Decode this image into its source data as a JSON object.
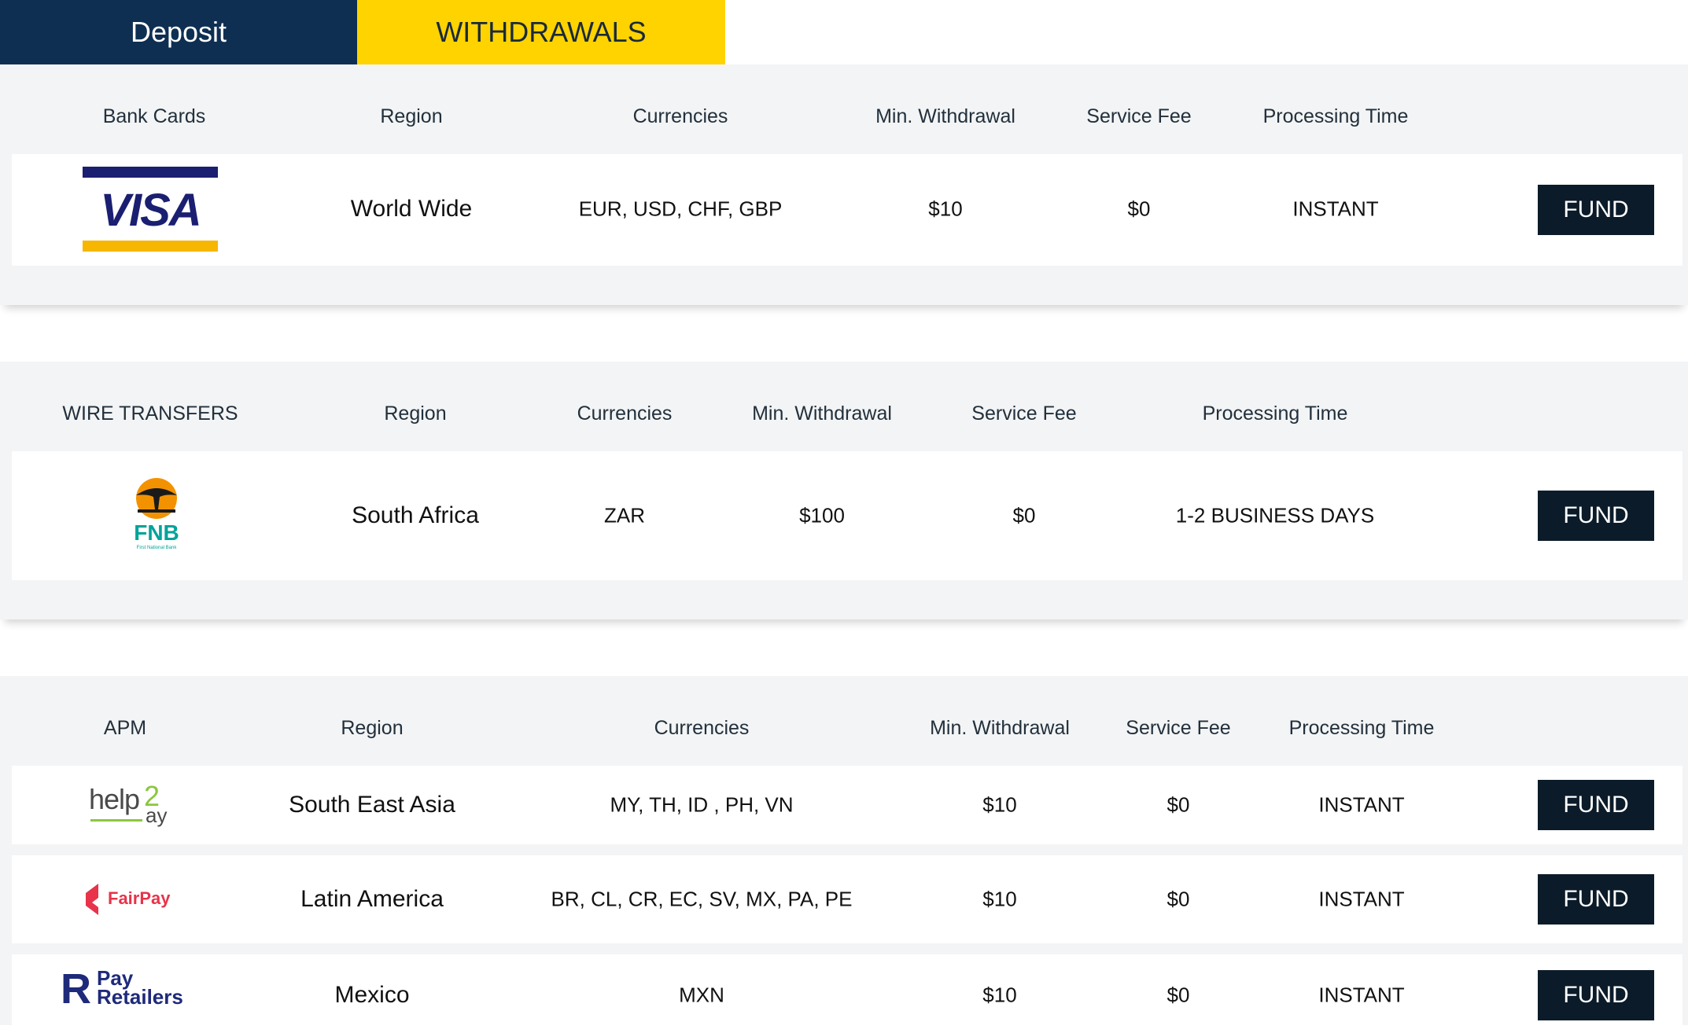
{
  "tabs": {
    "deposit": "Deposit",
    "withdrawals": "WITHDRAWALS"
  },
  "sections": {
    "bank_cards": {
      "headers": [
        "Bank Cards",
        "Region",
        "Currencies",
        "Min. Withdrawal",
        "Service Fee",
        "Processing Time"
      ],
      "rows": [
        {
          "logo": "visa-logo",
          "logo_text": "VISA",
          "region": "World Wide",
          "currencies": "EUR, USD, CHF, GBP",
          "min": "$10",
          "fee": "$0",
          "time": "INSTANT",
          "action": "FUND"
        }
      ]
    },
    "wire_transfers": {
      "headers": [
        "WIRE TRANSFERS",
        "Region",
        "Currencies",
        "Min. Withdrawal",
        "Service Fee",
        "Processing Time"
      ],
      "rows": [
        {
          "logo": "fnb-logo",
          "logo_text": "FNB",
          "logo_subtext": "First National Bank",
          "region": "South Africa",
          "currencies": "ZAR",
          "min": "$100",
          "fee": "$0",
          "time": "1-2 BUSINESS DAYS",
          "action": "FUND"
        }
      ]
    },
    "apm": {
      "headers": [
        "APM",
        "Region",
        "Currencies",
        "Min. Withdrawal",
        "Service Fee",
        "Processing Time"
      ],
      "rows": [
        {
          "logo": "help2pay-logo",
          "logo_text": "help2pay",
          "region": "South East Asia",
          "currencies": "MY, TH, ID , PH, VN",
          "min": "$10",
          "fee": "$0",
          "time": "INSTANT",
          "action": "FUND"
        },
        {
          "logo": "fairpay-logo",
          "logo_text": "FairPay",
          "region": "Latin America",
          "currencies": "BR, CL, CR, EC, SV, MX, PA, PE",
          "min": "$10",
          "fee": "$0",
          "time": "INSTANT",
          "action": "FUND"
        },
        {
          "logo": "payretailers-logo",
          "logo_text": "Pay Retailers",
          "region": "Mexico",
          "currencies": "MXN",
          "min": "$10",
          "fee": "$0",
          "time": "INSTANT",
          "action": "FUND"
        }
      ]
    }
  },
  "colors": {
    "navy": "#0e2f52",
    "yellow": "#ffd300",
    "button": "#0b1b2a",
    "section_bg": "#f3f4f5"
  }
}
